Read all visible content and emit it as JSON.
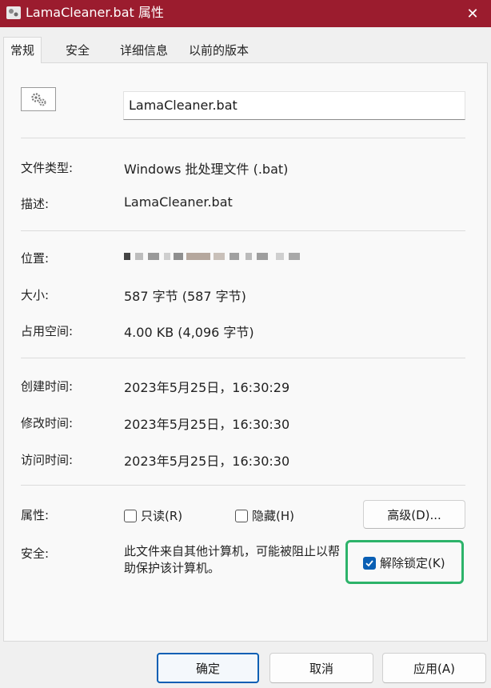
{
  "window": {
    "title": "LamaCleaner.bat 属性",
    "close_symbol": "✕"
  },
  "tabs": [
    "常规",
    "安全",
    "详细信息",
    "以前的版本"
  ],
  "file": {
    "name": "LamaCleaner.bat"
  },
  "fields": {
    "type_label": "文件类型:",
    "type_value": "Windows 批处理文件 (.bat)",
    "desc_label": "描述:",
    "desc_value": "LamaCleaner.bat",
    "location_label": "位置:",
    "size_label": "大小:",
    "size_value": "587 字节 (587 字节)",
    "disk_label": "占用空间:",
    "disk_value": "4.00 KB (4,096 字节)",
    "created_label": "创建时间:",
    "created_value": "2023年5月25日，16:30:29",
    "modified_label": "修改时间:",
    "modified_value": "2023年5月25日，16:30:30",
    "accessed_label": "访问时间:",
    "accessed_value": "2023年5月25日，16:30:30"
  },
  "attributes": {
    "label": "属性:",
    "readonly": {
      "label": "只读(R)",
      "checked": false
    },
    "hidden": {
      "label": "隐藏(H)",
      "checked": false
    },
    "advanced_button": "高级(D)..."
  },
  "security": {
    "label": "安全:",
    "message": "此文件来自其他计算机，可能被阻止以帮助保护该计算机。",
    "unblock": {
      "label": "解除锁定(K)",
      "checked": true
    }
  },
  "buttons": {
    "ok": "确定",
    "cancel": "取消",
    "apply": "应用(A)"
  },
  "colors": {
    "titlebar": "#9b1c2e",
    "accent": "#0a5fb4",
    "highlight": "#2db36a"
  }
}
